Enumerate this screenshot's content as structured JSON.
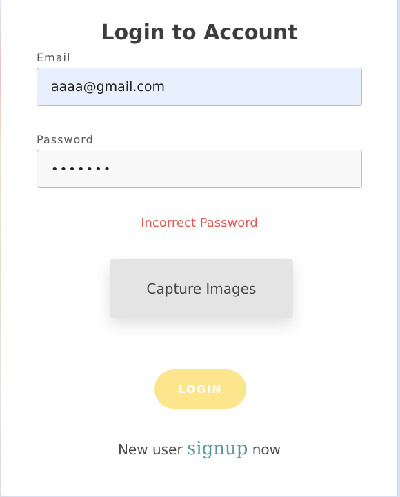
{
  "title": "Login to Account",
  "form": {
    "email_label": "Email",
    "email_value": "aaaa@gmail.com",
    "password_label": "Password",
    "password_value": "•••••••",
    "error_message": "Incorrect Password",
    "capture_button_label": "Capture Images",
    "login_button_label": "LOGIN"
  },
  "footer": {
    "prefix": "New user",
    "link_label": "signup",
    "suffix": "now"
  },
  "colors": {
    "error": "#e35555",
    "login_button": "#fde58d",
    "signup_link": "#5c9699",
    "email_field_background": "#e8f0fe"
  }
}
